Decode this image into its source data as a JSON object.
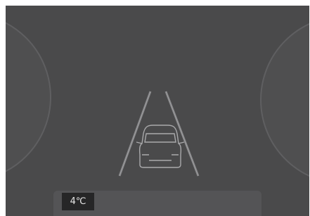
{
  "dashboard": {
    "outside_temperature": "4℃",
    "colors": {
      "background": "#4a4a4b",
      "lane_lines": "#8c8c8e",
      "vehicle_outline": "#a9a9ab",
      "gauge_border": "#5f5f61",
      "temperature_box": "#262627"
    },
    "icons": {
      "vehicle": "car-rear-view-icon",
      "lanes": "lane-markings-icon"
    }
  }
}
